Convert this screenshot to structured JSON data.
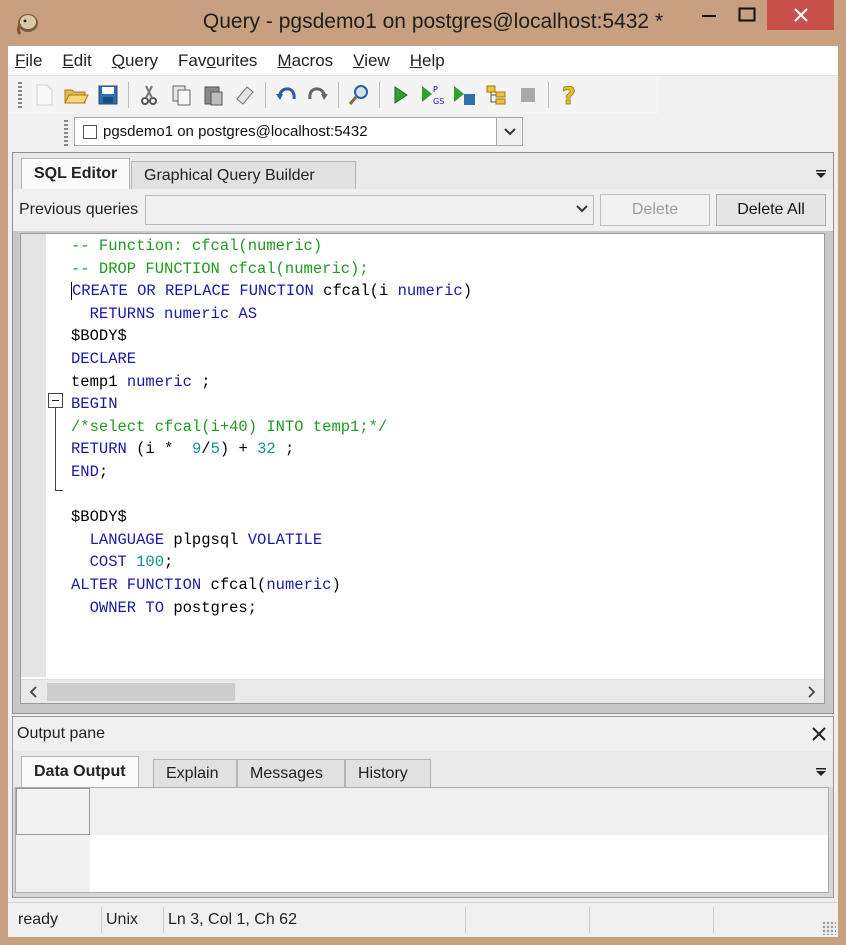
{
  "window": {
    "title": "Query - pgsdemo1 on postgres@localhost:5432 *",
    "controls": [
      "minimize",
      "maximize",
      "close"
    ]
  },
  "menu": [
    {
      "pre": "",
      "u": "F",
      "post": "ile"
    },
    {
      "pre": "",
      "u": "E",
      "post": "dit"
    },
    {
      "pre": "",
      "u": "Q",
      "post": "uery"
    },
    {
      "pre": "Fav",
      "u": "o",
      "post": "urites"
    },
    {
      "pre": "",
      "u": "M",
      "post": "acros"
    },
    {
      "pre": "",
      "u": "V",
      "post": "iew"
    },
    {
      "pre": "",
      "u": "H",
      "post": "elp"
    }
  ],
  "toolbar": {
    "icons": [
      "new-file-icon",
      "open-folder-icon",
      "save-icon",
      "cut-icon",
      "copy-icon",
      "paste-icon",
      "clear-icon",
      "undo-icon",
      "redo-icon",
      "find-icon",
      "execute-icon",
      "execute-pgscript-icon",
      "execute-to-file-icon",
      "explain-icon",
      "cancel-query-icon",
      "help-icon"
    ]
  },
  "connection": {
    "selected": "pgsdemo1 on postgres@localhost:5432"
  },
  "editor_tabs": {
    "sql_editor": "SQL Editor",
    "graphical_builder": "Graphical Query Builder"
  },
  "previous_queries": {
    "label": "Previous queries",
    "value": "",
    "delete": "Delete",
    "delete_all": "Delete All"
  },
  "sql_lines": [
    [
      {
        "t": "-- Function: cfcal(numeric)",
        "c": "cm"
      }
    ],
    [
      {
        "t": "-- DROP FUNCTION cfcal(numeric);",
        "c": "cm"
      }
    ],
    [
      {
        "t": "CREATE OR REPLACE FUNCTION",
        "c": "kw"
      },
      {
        "t": " cfcal(i ",
        "c": ""
      },
      {
        "t": "numeric",
        "c": "kw"
      },
      {
        "t": ")",
        "c": ""
      }
    ],
    [
      {
        "t": "  RETURNS numeric AS",
        "c": "kw"
      }
    ],
    [
      {
        "t": "$BODY$",
        "c": ""
      }
    ],
    [
      {
        "t": "DECLARE",
        "c": "kw"
      }
    ],
    [
      {
        "t": "temp1 ",
        "c": ""
      },
      {
        "t": "numeric",
        "c": "kw"
      },
      {
        "t": " ;",
        "c": ""
      }
    ],
    [
      {
        "t": "BEGIN",
        "c": "kw"
      }
    ],
    [
      {
        "t": "/*select cfcal(i+40) INTO temp1;*/",
        "c": "cm"
      }
    ],
    [
      {
        "t": "RETURN",
        "c": "kw"
      },
      {
        "t": " (i *  ",
        "c": ""
      },
      {
        "t": "9",
        "c": "num"
      },
      {
        "t": "/",
        "c": ""
      },
      {
        "t": "5",
        "c": "num"
      },
      {
        "t": ") + ",
        "c": ""
      },
      {
        "t": "32",
        "c": "num"
      },
      {
        "t": " ;",
        "c": ""
      }
    ],
    [
      {
        "t": "END",
        "c": "kw"
      },
      {
        "t": ";",
        "c": ""
      }
    ],
    [
      {
        "t": "",
        "c": ""
      }
    ],
    [
      {
        "t": "$BODY$",
        "c": ""
      }
    ],
    [
      {
        "t": "  LANGUAGE",
        "c": "kw"
      },
      {
        "t": " plpgsql ",
        "c": ""
      },
      {
        "t": "VOLATILE",
        "c": "kw"
      }
    ],
    [
      {
        "t": "  COST",
        "c": "kw"
      },
      {
        "t": " ",
        "c": ""
      },
      {
        "t": "100",
        "c": "num"
      },
      {
        "t": ";",
        "c": ""
      }
    ],
    [
      {
        "t": "ALTER FUNCTION",
        "c": "kw"
      },
      {
        "t": " cfcal(",
        "c": ""
      },
      {
        "t": "numeric",
        "c": "kw"
      },
      {
        "t": ")",
        "c": ""
      }
    ],
    [
      {
        "t": "  OWNER TO",
        "c": "kw"
      },
      {
        "t": " postgres;",
        "c": ""
      }
    ]
  ],
  "output": {
    "title": "Output pane",
    "tabs": [
      "Data Output",
      "Explain",
      "Messages",
      "History"
    ]
  },
  "status": {
    "state": "ready",
    "line_endings": "Unix",
    "position": "Ln 3, Col 1, Ch 62"
  },
  "colors": {
    "keyword": "#1a1aa6",
    "comment": "#1f9a1f",
    "number": "#138f8f",
    "close_button": "#c7504b",
    "window_frame": "#c7a07f"
  }
}
